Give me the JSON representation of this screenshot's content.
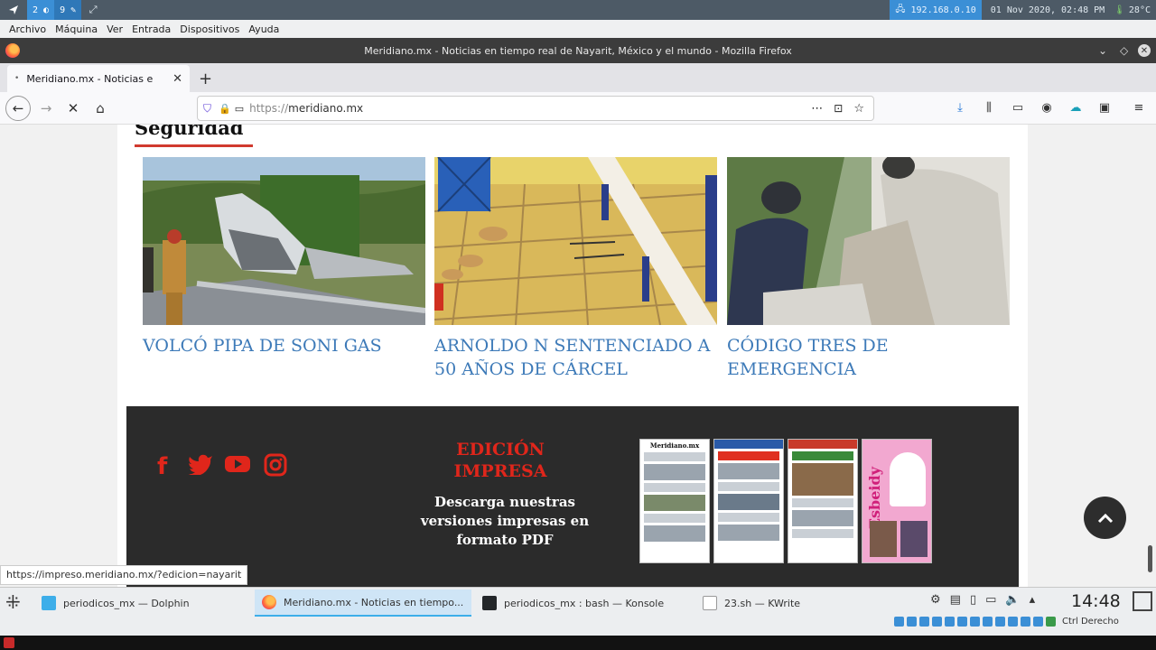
{
  "vm_panel": {
    "ws1": "2",
    "ws2": "9",
    "ip": "192.168.0.10",
    "datetime": "01 Nov 2020, 02:48 PM",
    "temp": "28°C"
  },
  "vm_menu": [
    "Archivo",
    "Máquina",
    "Ver",
    "Entrada",
    "Dispositivos",
    "Ayuda"
  ],
  "window_title": "Meridiano.mx - Noticias en tiempo real de Nayarit, México y el mundo - Mozilla Firefox",
  "tab": {
    "label": "Meridiano.mx - Noticias e"
  },
  "url": {
    "proto": "https://",
    "host": "meridiano.mx"
  },
  "page": {
    "section_title": "Seguridad",
    "news": [
      {
        "title": "VOLCÓ PIPA DE SONI GAS"
      },
      {
        "title": "ARNOLDO N SENTENCIADO A 50 AÑOS DE CÁRCEL"
      },
      {
        "title": "CÓDIGO TRES DE EMERGENCIA"
      }
    ],
    "footer": {
      "edicion": "EDICIÓN IMPRESA",
      "descarga": "Descarga nuestras versiones impresas en formato PDF",
      "paper_labels": [
        "Meridiano.mx",
        "",
        "",
        "Esbeidy"
      ]
    }
  },
  "status_url": "https://impreso.meridiano.mx/?edicion=nayarit",
  "taskbar": {
    "tasks": [
      {
        "label": "periodicos_mx — Dolphin"
      },
      {
        "label": "Meridiano.mx - Noticias en tiempo..."
      },
      {
        "label": "periodicos_mx : bash — Konsole"
      },
      {
        "label": "23.sh — KWrite"
      }
    ],
    "clock": "14:48",
    "tray_text": "Ctrl Derecho"
  },
  "colors": {
    "accent": "#3b8fd6",
    "brand_red": "#e0261b",
    "link_blue": "#3d7ab8"
  }
}
